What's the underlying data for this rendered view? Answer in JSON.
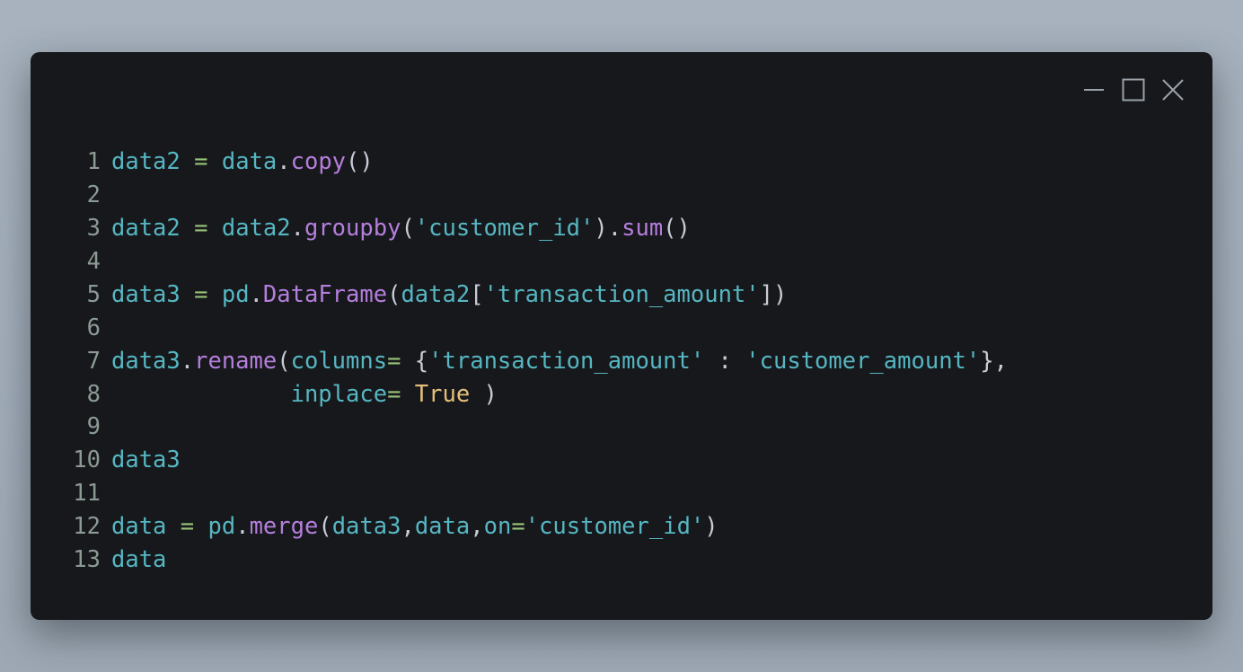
{
  "window": {
    "controls": {
      "minimize": "minimize",
      "maximize": "maximize",
      "close": "close"
    },
    "icons": [
      "minimize-icon",
      "maximize-icon",
      "close-icon"
    ]
  },
  "theme": {
    "background": "#16181b",
    "line_number": "#8b9a93",
    "identifier": "#56b6c2",
    "operator": "#98c379",
    "function": "#b57edc",
    "string": "#56b6c2",
    "punctuation": "#c8ccd4",
    "keyword_const": "#e5c07b"
  },
  "code": {
    "lines": [
      {
        "n": "1",
        "tokens": [
          {
            "t": "data2",
            "c": "identifier"
          },
          {
            "t": " ",
            "c": "punctuation"
          },
          {
            "t": "=",
            "c": "operator"
          },
          {
            "t": " ",
            "c": "punctuation"
          },
          {
            "t": "data",
            "c": "identifier"
          },
          {
            "t": ".",
            "c": "punctuation"
          },
          {
            "t": "copy",
            "c": "function"
          },
          {
            "t": "()",
            "c": "punctuation"
          }
        ]
      },
      {
        "n": "2",
        "tokens": []
      },
      {
        "n": "3",
        "tokens": [
          {
            "t": "data2",
            "c": "identifier"
          },
          {
            "t": " ",
            "c": "punctuation"
          },
          {
            "t": "=",
            "c": "operator"
          },
          {
            "t": " ",
            "c": "punctuation"
          },
          {
            "t": "data2",
            "c": "identifier"
          },
          {
            "t": ".",
            "c": "punctuation"
          },
          {
            "t": "groupby",
            "c": "function"
          },
          {
            "t": "(",
            "c": "punctuation"
          },
          {
            "t": "'customer_id'",
            "c": "string"
          },
          {
            "t": ").",
            "c": "punctuation"
          },
          {
            "t": "sum",
            "c": "function"
          },
          {
            "t": "()",
            "c": "punctuation"
          }
        ]
      },
      {
        "n": "4",
        "tokens": []
      },
      {
        "n": "5",
        "tokens": [
          {
            "t": "data3",
            "c": "identifier"
          },
          {
            "t": " ",
            "c": "punctuation"
          },
          {
            "t": "=",
            "c": "operator"
          },
          {
            "t": " ",
            "c": "punctuation"
          },
          {
            "t": "pd",
            "c": "identifier"
          },
          {
            "t": ".",
            "c": "punctuation"
          },
          {
            "t": "DataFrame",
            "c": "function"
          },
          {
            "t": "(",
            "c": "punctuation"
          },
          {
            "t": "data2",
            "c": "identifier"
          },
          {
            "t": "[",
            "c": "punctuation"
          },
          {
            "t": "'transaction_amount'",
            "c": "string"
          },
          {
            "t": "])",
            "c": "punctuation"
          }
        ]
      },
      {
        "n": "6",
        "tokens": []
      },
      {
        "n": "7",
        "tokens": [
          {
            "t": "data3",
            "c": "identifier"
          },
          {
            "t": ".",
            "c": "punctuation"
          },
          {
            "t": "rename",
            "c": "function"
          },
          {
            "t": "(",
            "c": "punctuation"
          },
          {
            "t": "columns",
            "c": "identifier"
          },
          {
            "t": "=",
            "c": "operator"
          },
          {
            "t": " {",
            "c": "punctuation"
          },
          {
            "t": "'transaction_amount'",
            "c": "string"
          },
          {
            "t": " : ",
            "c": "punctuation"
          },
          {
            "t": "'customer_amount'",
            "c": "string"
          },
          {
            "t": "},",
            "c": "punctuation"
          }
        ]
      },
      {
        "n": "8",
        "tight": true,
        "tokens": [
          {
            "t": "             ",
            "c": "punctuation"
          },
          {
            "t": "inplace",
            "c": "identifier"
          },
          {
            "t": "=",
            "c": "operator"
          },
          {
            "t": " ",
            "c": "punctuation"
          },
          {
            "t": "True",
            "c": "keyword_const"
          },
          {
            "t": " )",
            "c": "punctuation"
          }
        ]
      },
      {
        "n": "9",
        "tokens": []
      },
      {
        "n": "10",
        "tokens": [
          {
            "t": "data3",
            "c": "identifier"
          }
        ]
      },
      {
        "n": "11",
        "tokens": []
      },
      {
        "n": "12",
        "tokens": [
          {
            "t": "data",
            "c": "identifier"
          },
          {
            "t": " ",
            "c": "punctuation"
          },
          {
            "t": "=",
            "c": "operator"
          },
          {
            "t": " ",
            "c": "punctuation"
          },
          {
            "t": "pd",
            "c": "identifier"
          },
          {
            "t": ".",
            "c": "punctuation"
          },
          {
            "t": "merge",
            "c": "function"
          },
          {
            "t": "(",
            "c": "punctuation"
          },
          {
            "t": "data3",
            "c": "identifier"
          },
          {
            "t": ",",
            "c": "punctuation"
          },
          {
            "t": "data",
            "c": "identifier"
          },
          {
            "t": ",",
            "c": "punctuation"
          },
          {
            "t": "on",
            "c": "identifier"
          },
          {
            "t": "=",
            "c": "operator"
          },
          {
            "t": "'customer_id'",
            "c": "string"
          },
          {
            "t": ")",
            "c": "punctuation"
          }
        ]
      },
      {
        "n": "13",
        "tight": true,
        "tokens": [
          {
            "t": "data",
            "c": "identifier"
          }
        ]
      }
    ]
  }
}
